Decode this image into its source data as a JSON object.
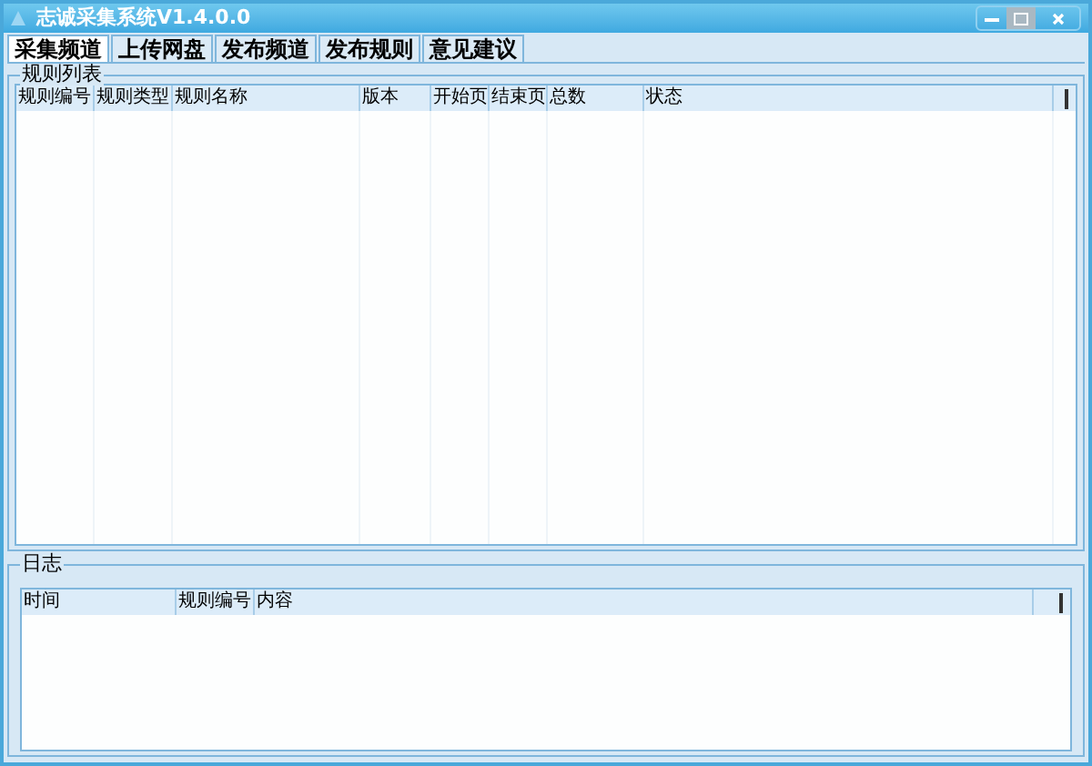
{
  "window": {
    "title": "志诚采集系统V1.4.0.0"
  },
  "tabs": [
    {
      "label": "采集频道",
      "selected": true
    },
    {
      "label": "上传网盘",
      "selected": false
    },
    {
      "label": "发布频道",
      "selected": false
    },
    {
      "label": "发布规则",
      "selected": false
    },
    {
      "label": "意见建议",
      "selected": false
    }
  ],
  "rule_list": {
    "title": "规则列表",
    "columns": [
      "规则编号",
      "规则类型",
      "规则名称",
      "版本",
      "开始页",
      "结束页",
      "总数",
      "状态"
    ]
  },
  "log": {
    "title": "日志",
    "columns": [
      "时间",
      "规则编号",
      "内容"
    ]
  }
}
